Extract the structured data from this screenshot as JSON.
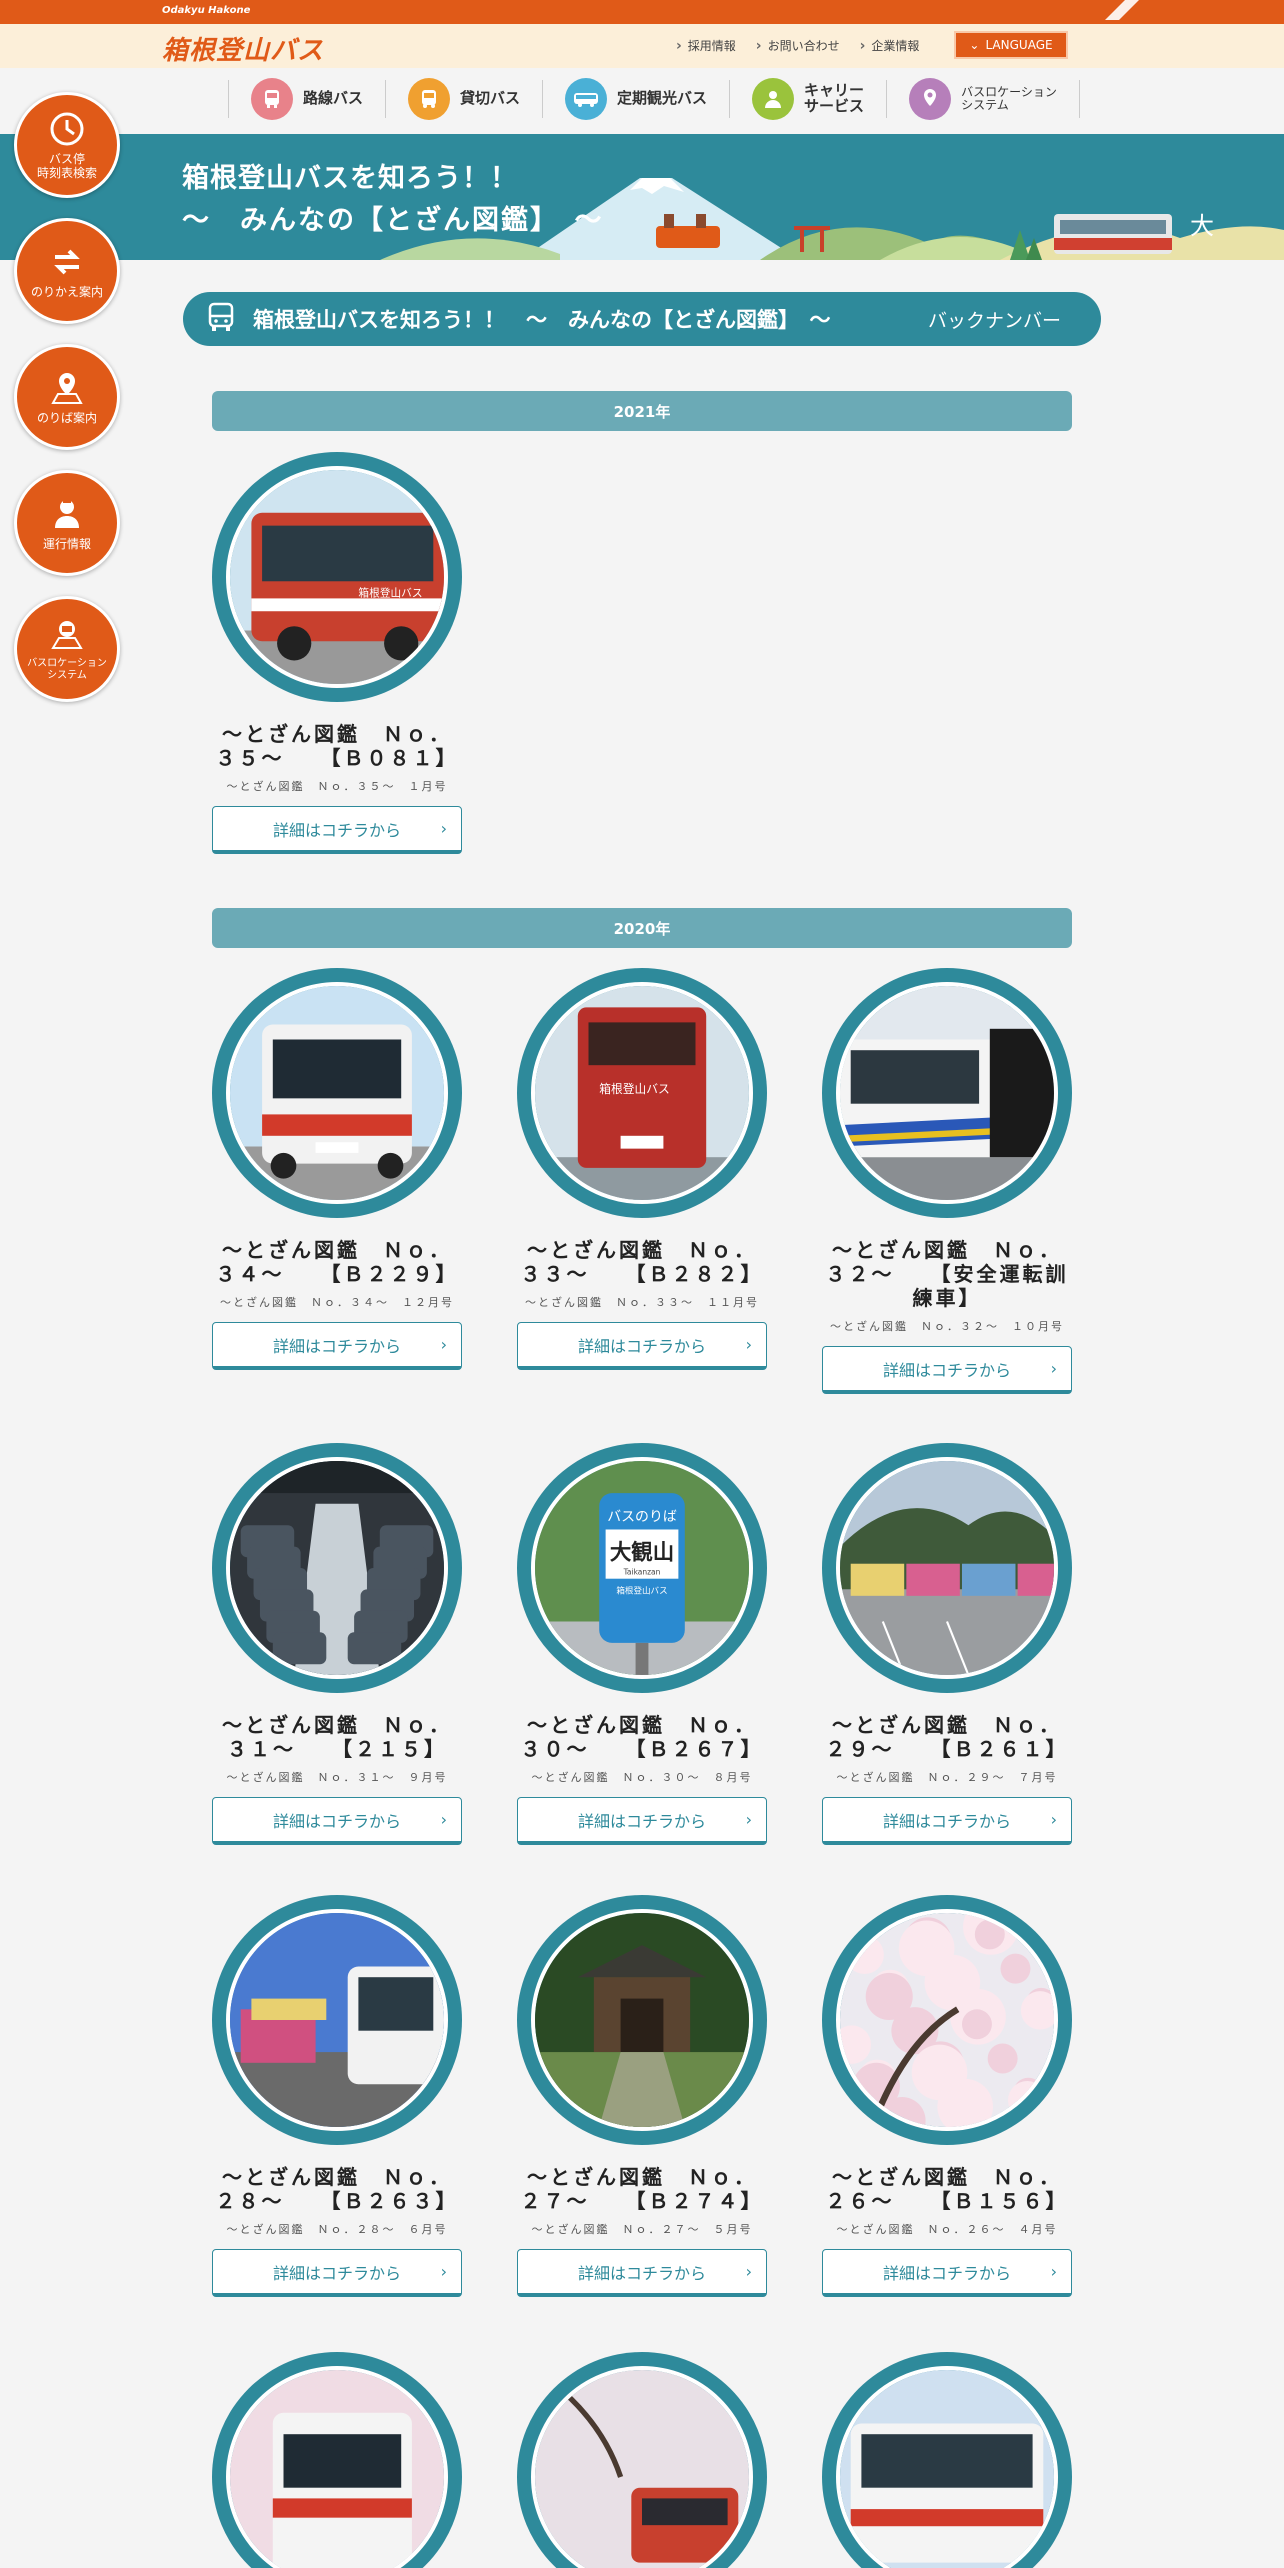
{
  "topbar": {
    "brand_small": "Odakyu Hakone"
  },
  "header": {
    "logo": "箱根登山バス",
    "links": [
      "採用情報",
      "お問い合わせ",
      "企業情報"
    ],
    "language": "LANGUAGE"
  },
  "gnav": [
    {
      "label": "路線バス",
      "icon": "bus-stop-icon",
      "color": "#e8828a"
    },
    {
      "label": "貸切バス",
      "icon": "charter-bus-icon",
      "color": "#f0a030"
    },
    {
      "label": "定期観光バス",
      "icon": "sightseeing-bus-icon",
      "color": "#4ab0d6"
    },
    {
      "label": "キャリー\nサービス",
      "icon": "carry-service-icon",
      "color": "#9ac33c"
    },
    {
      "label": "バスロケーション\nシステム",
      "icon": "bus-location-icon",
      "color": "#b67fba"
    }
  ],
  "sidenav": [
    {
      "label": "バス停\n時刻表検索",
      "icon": "clock-icon"
    },
    {
      "label": "のりかえ案内",
      "icon": "transfer-arrows-icon"
    },
    {
      "label": "のりば案内",
      "icon": "map-pin-icon"
    },
    {
      "label": "運行情報",
      "icon": "person-info-icon"
    },
    {
      "label": "バスロケーション\nシステム",
      "icon": "bus-location-icon"
    }
  ],
  "hero": {
    "line1": "箱根登山バスを知ろう！！",
    "line2": "～　みんなの【とざん図鑑】　～",
    "kanji": "大"
  },
  "banner": {
    "title": "箱根登山バスを知ろう！！　～　みんなの【とざん図鑑】　～",
    "backnumber": "バックナンバー"
  },
  "colors": {
    "accent": "#e05a18",
    "teal": "#2e8a9b",
    "year_bar": "#6baab6"
  },
  "years": [
    "2021年",
    "2020年"
  ],
  "button_label": "詳細はコチラから",
  "cards": [
    {
      "title": "～とざん図鑑　Ｎｏ．３５～　　【Ｂ０８１】",
      "sub": "～とざん図鑑　Ｎｏ．３５～　１月号",
      "scene": "bus-side-red"
    },
    {
      "title": "～とざん図鑑　Ｎｏ．３４～　　【Ｂ２２９】",
      "sub": "～とざん図鑑　Ｎｏ．３４～　１２月号",
      "scene": "bus-front"
    },
    {
      "title": "～とざん図鑑　Ｎｏ．３３～　　【Ｂ２８２】",
      "sub": "～とざん図鑑　Ｎｏ．３３～　１１月号",
      "scene": "bus-rear"
    },
    {
      "title": "～とざん図鑑　Ｎｏ．３２～　　【安全運転訓練車】",
      "sub": "～とざん図鑑　Ｎｏ．３２～　１０月号",
      "scene": "bus-blue-stripe"
    },
    {
      "title": "～とざん図鑑　Ｎｏ．３１～　　【２１５】",
      "sub": "～とざん図鑑　Ｎｏ．３１～　９月号",
      "scene": "bus-interior"
    },
    {
      "title": "～とざん図鑑　Ｎｏ．３０～　　【Ｂ２６７】",
      "sub": "～とざん図鑑　Ｎｏ．３０～　８月号",
      "scene": "bus-stop-sign"
    },
    {
      "title": "～とざん図鑑　Ｎｏ．２９～　　【Ｂ２６１】",
      "sub": "～とざん図鑑　Ｎｏ．２９～　７月号",
      "scene": "bus-parking"
    },
    {
      "title": "～とざん図鑑　Ｎｏ．２８～　　【Ｂ２６３】",
      "sub": "～とざん図鑑　Ｎｏ．２８～　６月号",
      "scene": "bus-terminal"
    },
    {
      "title": "～とざん図鑑　Ｎｏ．２７～　　【Ｂ２７４】",
      "sub": "～とざん図鑑　Ｎｏ．２７～　５月号",
      "scene": "temple-gate"
    },
    {
      "title": "～とざん図鑑　Ｎｏ．２６～　　【Ｂ１５６】",
      "sub": "～とざん図鑑　Ｎｏ．２６～　４月号",
      "scene": "cherry-blossom"
    },
    {
      "title": "",
      "sub": "",
      "scene": "bus-cherry-front"
    },
    {
      "title": "",
      "sub": "",
      "scene": "bus-cherry-road"
    },
    {
      "title": "",
      "sub": "",
      "scene": "bus-cherry-side"
    }
  ],
  "sign": {
    "top": "バスのりば",
    "name": "大観山",
    "roman": "Taikanzan",
    "brand": "箱根登山バス"
  },
  "bus_text": "箱根登山バス"
}
